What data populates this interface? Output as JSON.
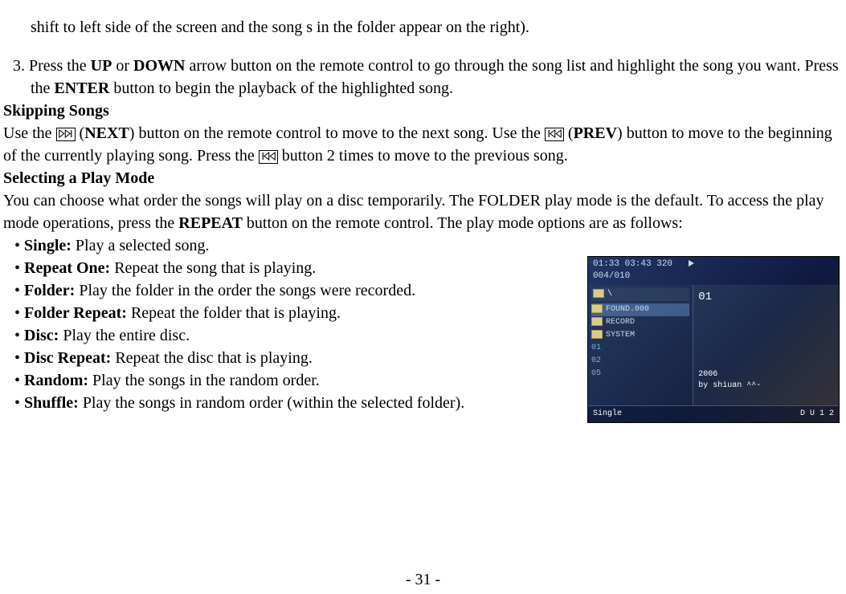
{
  "intro_cont": "shift to left side of the screen and the song s in the folder appear on the right).",
  "step3_pre": "3. Press the ",
  "step3_b1": "UP",
  "step3_m1": " or ",
  "step3_b2": "DOWN",
  "step3_m2": " arrow button on the remote control to go through the song list and highlight the song you want. Press the ",
  "step3_b3": "ENTER",
  "step3_m3": " button to begin the playback of the highlighted song.",
  "heading_skip": "Skipping Songs",
  "skip_p1": "Use the ",
  "skip_p2": " (",
  "skip_b1": "NEXT",
  "skip_p3": ") button on the remote control to move to the next song. Use the ",
  "skip_p4": " (",
  "skip_b2": "PREV",
  "skip_p5": ") button to move to the beginning of the currently playing song. Press the ",
  "skip_p6": " button 2 times to move to the previous song.",
  "heading_mode": "Selecting a Play Mode",
  "mode_p1": "You can choose what order the songs will play on a disc temporarily. The FOLDER play mode is the default. To access the play mode operations, press the ",
  "mode_b1": "REPEAT",
  "mode_p2": " button on the remote control. The play mode options are as follows:",
  "modes": {
    "single": {
      "label": "Single:",
      "desc": " Play a selected song."
    },
    "repeat_one": {
      "label": "Repeat One:",
      "desc": " Repeat the song that is playing."
    },
    "folder": {
      "label": "Folder:",
      "desc": " Play the folder in the order the songs were recorded."
    },
    "folder_repeat": {
      "label": "Folder Repeat:",
      "desc": " Repeat the folder that is playing."
    },
    "disc": {
      "label": "Disc:",
      "desc": " Play the entire disc."
    },
    "disc_repeat": {
      "label": "Disc Repeat:",
      "desc": " Repeat the disc that is playing."
    },
    "random": {
      "label": "Random:",
      "desc": " Play the songs in the random order."
    },
    "shuffle": {
      "label": "Shuffle:",
      "desc": " Play the songs in random order (within the selected folder)."
    }
  },
  "screenshot": {
    "header_line1": "01:33  03:43   320",
    "header_line2": "004/010",
    "root": "\\",
    "left_items": [
      {
        "num": "",
        "label": "FOUND.000",
        "hl": true
      },
      {
        "num": "",
        "label": "RECORD",
        "hl": false
      },
      {
        "num": "",
        "label": "SYSTEM",
        "hl": false
      },
      {
        "num": "01",
        "label": "",
        "hl": false
      },
      {
        "num": "02",
        "label": "",
        "hl": false
      },
      {
        "num": "05",
        "label": "",
        "hl": false
      }
    ],
    "right_line1": "01",
    "right_line2": "2006",
    "right_line3": "by shiuan ^^-",
    "footer_left": "Single",
    "footer_right": "D  U  1  2"
  },
  "page_number": "- 31 -"
}
